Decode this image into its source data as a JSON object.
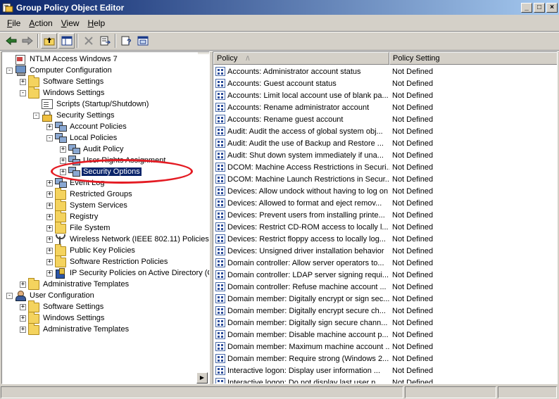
{
  "window": {
    "title": "Group Policy Object Editor",
    "controls": {
      "minimize": "_",
      "maximize": "□",
      "close": "×"
    }
  },
  "menu": {
    "items": [
      {
        "label": "File",
        "accel": "F",
        "rest": "ile"
      },
      {
        "label": "Action",
        "accel": "A",
        "rest": "ction"
      },
      {
        "label": "View",
        "accel": "V",
        "rest": "iew"
      },
      {
        "label": "Help",
        "accel": "H",
        "rest": "elp"
      }
    ]
  },
  "toolbar": {
    "icons": [
      "back-arrow-icon",
      "forward-arrow-icon",
      "up-folder-icon",
      "show-hide-tree-icon",
      "delete-icon",
      "export-list-icon",
      "help-icon",
      "properties-icon"
    ]
  },
  "tree": {
    "nodes": [
      {
        "label": "NTLM Access Windows 7",
        "icon": "root",
        "level": 0,
        "exp": "none"
      },
      {
        "label": "Computer Configuration",
        "icon": "computer",
        "level": 0,
        "exp": "-"
      },
      {
        "label": "Software Settings",
        "icon": "folder",
        "level": 1,
        "exp": "+"
      },
      {
        "label": "Windows Settings",
        "icon": "folder",
        "level": 1,
        "exp": "-"
      },
      {
        "label": "Scripts (Startup/Shutdown)",
        "icon": "doc",
        "level": 2,
        "exp": "none"
      },
      {
        "label": "Security Settings",
        "icon": "padlock",
        "level": 2,
        "exp": "-"
      },
      {
        "label": "Account Policies",
        "icon": "computers",
        "level": 3,
        "exp": "+"
      },
      {
        "label": "Local Policies",
        "icon": "computers",
        "level": 3,
        "exp": "-"
      },
      {
        "label": "Audit Policy",
        "icon": "computers",
        "level": 4,
        "exp": "+"
      },
      {
        "label": "User Rights Assignment",
        "icon": "computers",
        "level": 4,
        "exp": "+"
      },
      {
        "label": "Security Options",
        "icon": "computers",
        "level": 4,
        "exp": "+",
        "selected": true
      },
      {
        "label": "Event Log",
        "icon": "computers",
        "level": 3,
        "exp": "+"
      },
      {
        "label": "Restricted Groups",
        "icon": "folder",
        "level": 3,
        "exp": "+"
      },
      {
        "label": "System Services",
        "icon": "folder",
        "level": 3,
        "exp": "+"
      },
      {
        "label": "Registry",
        "icon": "folder",
        "level": 3,
        "exp": "+"
      },
      {
        "label": "File System",
        "icon": "folder",
        "level": 3,
        "exp": "+"
      },
      {
        "label": "Wireless Network (IEEE 802.11) Policies",
        "icon": "antenna",
        "level": 3,
        "exp": "+"
      },
      {
        "label": "Public Key Policies",
        "icon": "folder",
        "level": 3,
        "exp": "+"
      },
      {
        "label": "Software Restriction Policies",
        "icon": "folder",
        "level": 3,
        "exp": "+"
      },
      {
        "label": "IP Security Policies on Active Directory (C",
        "icon": "ipsec",
        "level": 3,
        "exp": "+"
      },
      {
        "label": "Administrative Templates",
        "icon": "folder",
        "level": 1,
        "exp": "+"
      },
      {
        "label": "User Configuration",
        "icon": "user",
        "level": 0,
        "exp": "-"
      },
      {
        "label": "Software Settings",
        "icon": "folder",
        "level": 1,
        "exp": "+"
      },
      {
        "label": "Windows Settings",
        "icon": "folder",
        "level": 1,
        "exp": "+"
      },
      {
        "label": "Administrative Templates",
        "icon": "folder",
        "level": 1,
        "exp": "+"
      }
    ]
  },
  "list": {
    "columns": {
      "policy": "Policy",
      "policy_setting": "Policy Setting"
    },
    "sort_indicator": "/\\",
    "rows": [
      {
        "policy": "Accounts: Administrator account status",
        "setting": "Not Defined"
      },
      {
        "policy": "Accounts: Guest account status",
        "setting": "Not Defined"
      },
      {
        "policy": "Accounts: Limit local account use of blank pa...",
        "setting": "Not Defined"
      },
      {
        "policy": "Accounts: Rename administrator account",
        "setting": "Not Defined"
      },
      {
        "policy": "Accounts: Rename guest account",
        "setting": "Not Defined"
      },
      {
        "policy": "Audit: Audit the access of global system obj...",
        "setting": "Not Defined"
      },
      {
        "policy": "Audit: Audit the use of Backup and Restore ...",
        "setting": "Not Defined"
      },
      {
        "policy": "Audit: Shut down system immediately if una...",
        "setting": "Not Defined"
      },
      {
        "policy": "DCOM: Machine Access Restrictions in Securi...",
        "setting": "Not Defined"
      },
      {
        "policy": "DCOM: Machine Launch Restrictions in Secur...",
        "setting": "Not Defined"
      },
      {
        "policy": "Devices: Allow undock without having to log on",
        "setting": "Not Defined"
      },
      {
        "policy": "Devices: Allowed to format and eject remov...",
        "setting": "Not Defined"
      },
      {
        "policy": "Devices: Prevent users from installing printe...",
        "setting": "Not Defined"
      },
      {
        "policy": "Devices: Restrict CD-ROM access to locally l...",
        "setting": "Not Defined"
      },
      {
        "policy": "Devices: Restrict floppy access to locally log...",
        "setting": "Not Defined"
      },
      {
        "policy": "Devices: Unsigned driver installation behavior",
        "setting": "Not Defined"
      },
      {
        "policy": "Domain controller: Allow server operators to...",
        "setting": "Not Defined"
      },
      {
        "policy": "Domain controller: LDAP server signing requi...",
        "setting": "Not Defined"
      },
      {
        "policy": "Domain controller: Refuse machine account ...",
        "setting": "Not Defined"
      },
      {
        "policy": "Domain member: Digitally encrypt or sign sec...",
        "setting": "Not Defined"
      },
      {
        "policy": "Domain member: Digitally encrypt secure ch...",
        "setting": "Not Defined"
      },
      {
        "policy": "Domain member: Digitally sign secure chann...",
        "setting": "Not Defined"
      },
      {
        "policy": "Domain member: Disable machine account p...",
        "setting": "Not Defined"
      },
      {
        "policy": "Domain member: Maximum machine account ...",
        "setting": "Not Defined"
      },
      {
        "policy": "Domain member: Require strong (Windows 2...",
        "setting": "Not Defined"
      },
      {
        "policy": "Interactive logon: Display user information ...",
        "setting": "Not Defined"
      },
      {
        "policy": "Interactive logon: Do not display last user n...",
        "setting": "Not Defined"
      }
    ]
  },
  "annotation": {
    "color": "#e41b23",
    "target": "Security Options"
  },
  "colors": {
    "title_start": "#0a246a",
    "title_end": "#a6caf0",
    "selection": "#0a246a",
    "chrome": "#d4d0c8"
  }
}
